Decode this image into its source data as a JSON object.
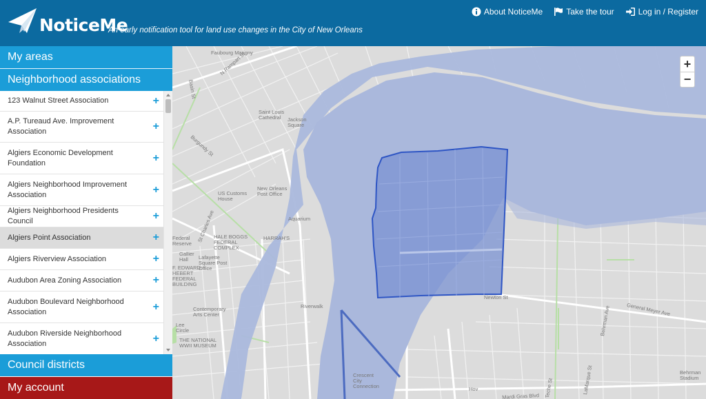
{
  "header": {
    "brand": "NoticeMe",
    "tagline": "An early notification tool for land use changes in the City of New Orleans",
    "nav": [
      {
        "label": "About NoticeMe",
        "icon": "info-icon"
      },
      {
        "label": "Take the tour",
        "icon": "flag-icon"
      },
      {
        "label": "Log in / Register",
        "icon": "login-icon"
      }
    ]
  },
  "sidebar": {
    "my_areas": "My areas",
    "neighborhood_associations": "Neighborhood associations",
    "council_districts": "Council districts",
    "my_account": "My account",
    "items": [
      {
        "label": "123 Walnut Street Association",
        "active": false
      },
      {
        "label": "A.P. Tureaud Ave. Improvement Association",
        "active": false
      },
      {
        "label": "Algiers Economic Development Foundation",
        "active": false
      },
      {
        "label": "Algiers Neighborhood Improvement Association",
        "active": false
      },
      {
        "label": "Algiers Neighborhood Presidents Council",
        "active": false
      },
      {
        "label": "Algiers Point Association",
        "active": true
      },
      {
        "label": "Algiers Riverview Association",
        "active": false
      },
      {
        "label": "Audubon Area Zoning Association",
        "active": false
      },
      {
        "label": "Audubon Boulevard Neighborhood Association",
        "active": false
      },
      {
        "label": "Audubon Riverside Neighborhood Association",
        "active": false
      }
    ]
  },
  "map": {
    "zoom_in": "+",
    "zoom_out": "−",
    "labels": {
      "faubourg": "Faubourg Marigny",
      "n_rampart": "N Rampart St",
      "basin": "Basin St",
      "st_louis": "Saint Louis Cathedral",
      "jackson": "Jackson Square",
      "burgundy": "Burgundy St",
      "customs": "US Customs House",
      "new_orleans_pf": "New Orleans Post Office",
      "aquarium": "Aquarium",
      "st_charles": "St Charles Ave",
      "hale": "HALE BOGGS FEDERAL COMPLEX",
      "harrahs": "HARRAH'S",
      "federal": "Federal Reserve",
      "lafayette": "Lafayette Square Post Office",
      "hebert": "F. EDWARD HEBERT FEDERAL BUILDING",
      "gallier": "Gallier Hall",
      "riverwalk": "Riverwalk",
      "newton": "Newton St",
      "general_meyer": "General Meyer Ave",
      "contemporary": "Contemporary Arts Center",
      "lee_circle": "Lee Circle",
      "national": "THE NATIONAL WWII MUSEUM",
      "crescent": "Crescent City Connection",
      "hov": "Hov",
      "mardi_gras": "Mardi Gras Blvd",
      "behrman_ave": "Behrman Ave",
      "behrman_stadium": "Behrman Stadium",
      "teche": "Teche St",
      "lamarque": "LaMarque St"
    }
  },
  "colors": {
    "header": "#0c6aa0",
    "section": "#1b9dd8",
    "account": "#a71818",
    "river": "#aab8dc",
    "polygon_fill": "#7b93d3",
    "polygon_stroke": "#2e55c4"
  }
}
